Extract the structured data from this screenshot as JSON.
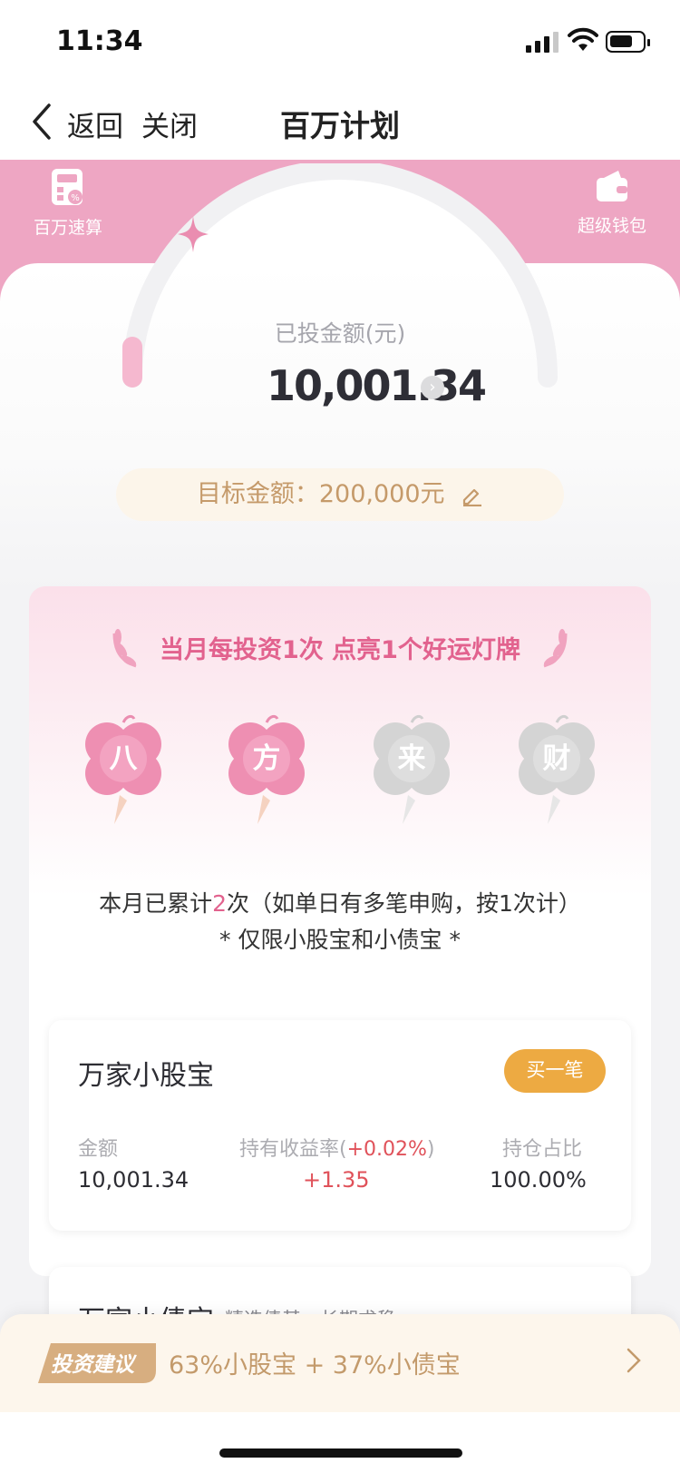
{
  "status_bar": {
    "time": "11:34"
  },
  "nav": {
    "back": "返回",
    "close": "关闭",
    "title": "百万计划"
  },
  "tools": {
    "left_label": "百万速算",
    "right_label": "超级钱包"
  },
  "summary": {
    "invested_label": "已投金额(元)",
    "invested_value": "10,001.34",
    "target_label": "目标金额：200,000元"
  },
  "lucky": {
    "title": "当月每投资1次 点亮1个好运灯牌",
    "clovers": [
      {
        "char": "八",
        "lit": true
      },
      {
        "char": "方",
        "lit": true
      },
      {
        "char": "来",
        "lit": false
      },
      {
        "char": "财",
        "lit": false
      }
    ],
    "count_prefix": "本月已累计",
    "count_num": "2",
    "count_suffix": "次（如单日有多笔申购，按1次计）",
    "limit_note": "* 仅限小股宝和小债宝 *"
  },
  "fund1": {
    "name": "万家小股宝",
    "buy_label": "买一笔",
    "amount_label": "金额",
    "amount_value": "10,001.34",
    "yield_label": "持有收益率(",
    "yield_rate": "+0.02%",
    "yield_close": ")",
    "yield_value": "+1.35",
    "ratio_label": "持仓占比",
    "ratio_value": "100.00%"
  },
  "fund2": {
    "name": "万家小债宝",
    "tag": "精选债基，长期求稳"
  },
  "suggestion": {
    "badge": "投资建议",
    "text": "63%小股宝 + 37%小债宝"
  },
  "colors": {
    "pink": "#eea6c3",
    "accent": "#e2628e",
    "gold": "#edaa42",
    "red": "#e0525a"
  },
  "icons": [
    "calculator-icon",
    "wallet-icon",
    "sparkle-icon",
    "pencil-icon",
    "chevron-right-icon",
    "back-arrow-icon"
  ]
}
